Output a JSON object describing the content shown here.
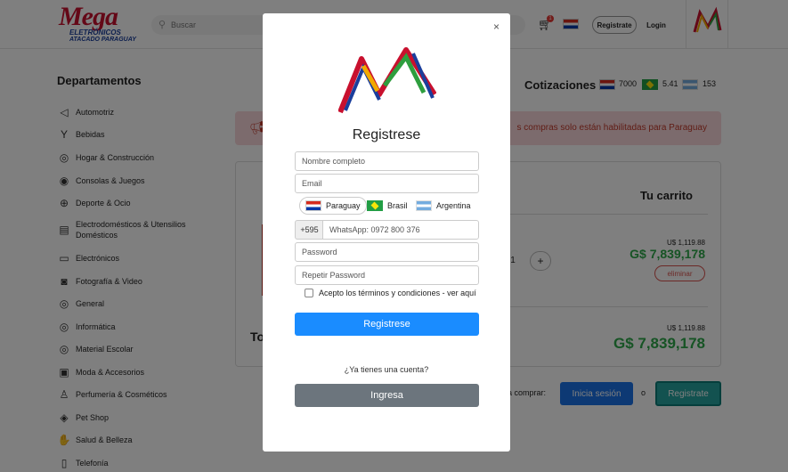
{
  "header": {
    "logo_text": "Mega",
    "logo_sub1": "ELETRÓNICOS",
    "logo_sub2": "ATACADO PARAGUAY",
    "search_placeholder": "Buscar",
    "cart_count": "1",
    "register_label": "Registrate",
    "login_label": "Login"
  },
  "sidebar": {
    "title": "Departamentos",
    "items": [
      {
        "label": "Automotriz",
        "icon": "car-icon",
        "glyph": "◁"
      },
      {
        "label": "Bebidas",
        "icon": "drink-icon",
        "glyph": "Y"
      },
      {
        "label": "Hogar & Construcción",
        "icon": "bulb-icon",
        "glyph": "◎"
      },
      {
        "label": "Consolas & Juegos",
        "icon": "gamepad-icon",
        "glyph": "◉"
      },
      {
        "label": "Deporte & Ocio",
        "icon": "ball-icon",
        "glyph": "⊕"
      },
      {
        "label": "Electrodomésticos & Utensilios Domésticos",
        "icon": "appliance-icon",
        "glyph": "▤"
      },
      {
        "label": "Electrónicos",
        "icon": "monitor-icon",
        "glyph": "▭"
      },
      {
        "label": "Fotografía & Video",
        "icon": "camera-icon",
        "glyph": "◙"
      },
      {
        "label": "General",
        "icon": "general-icon",
        "glyph": "◎"
      },
      {
        "label": "Informática",
        "icon": "computer-icon",
        "glyph": "◎"
      },
      {
        "label": "Material Escolar",
        "icon": "school-icon",
        "glyph": "◎"
      },
      {
        "label": "Moda & Accesorios",
        "icon": "fashion-icon",
        "glyph": "▣"
      },
      {
        "label": "Perfumería & Cosméticos",
        "icon": "perfume-icon",
        "glyph": "♙"
      },
      {
        "label": "Pet Shop",
        "icon": "pet-icon",
        "glyph": "◈"
      },
      {
        "label": "Salud & Belleza",
        "icon": "health-icon",
        "glyph": "✋"
      },
      {
        "label": "Telefonía",
        "icon": "phone-icon",
        "glyph": "▯"
      }
    ]
  },
  "cotizaciones": {
    "title": "Cotizaciones",
    "py": "7000",
    "br": "5.41",
    "ar": "153"
  },
  "alert": {
    "text": "s compras solo están habilitadas para Paraguay"
  },
  "cart": {
    "title": "Tu carrito",
    "qty": "1",
    "plus": "+",
    "item_usd": "U$ 1,119.88",
    "item_gs": "G$ 7,839,178",
    "remove_label": "eliminar",
    "total_label": "To",
    "total_usd": "U$ 1,119.88",
    "total_gs": "G$ 7,839,178",
    "para_comprar": "ara comprar:",
    "inicia_label": "Inicia sesión",
    "o_label": "o",
    "registrate_label": "Registrate"
  },
  "modal": {
    "close": "×",
    "title": "Registrese",
    "nombre_placeholder": "Nombre completo",
    "email_placeholder": "Email",
    "countries": [
      "Paraguay",
      "Brasil",
      "Argentina"
    ],
    "prefix": "+595",
    "whatsapp_placeholder": "WhatsApp: 0972 800 376",
    "password_placeholder": "Password",
    "repeat_placeholder": "Repetir Password",
    "terms_label": "Acepto los términos y condiciones - ver aquí",
    "submit_label": "Registrese",
    "ya_tienes": "¿Ya tienes una cuenta?",
    "ingresa_label": "Ingresa"
  }
}
